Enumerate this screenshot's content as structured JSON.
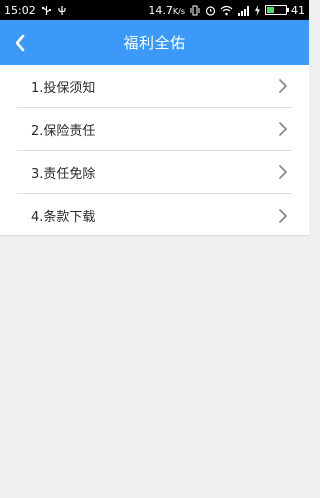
{
  "status_bar": {
    "time": "15:02",
    "speed": "14.7",
    "speed_unit": "K/s",
    "battery": "41",
    "battery_level_percent": 41,
    "icons": [
      "usb-icon",
      "usb-debug-icon",
      "vibrate-icon",
      "alarm-icon",
      "wifi-icon",
      "signal-icon",
      "charging-icon",
      "battery-icon"
    ]
  },
  "header": {
    "title": "福利全佑",
    "back_icon": "chevron-left-icon",
    "background": "#3c99f7"
  },
  "menu": {
    "items": [
      {
        "label": "1.投保须知"
      },
      {
        "label": "2.保险责任"
      },
      {
        "label": "3.责任免除"
      },
      {
        "label": "4.条款下载"
      }
    ],
    "chevron_icon": "chevron-right-icon"
  }
}
